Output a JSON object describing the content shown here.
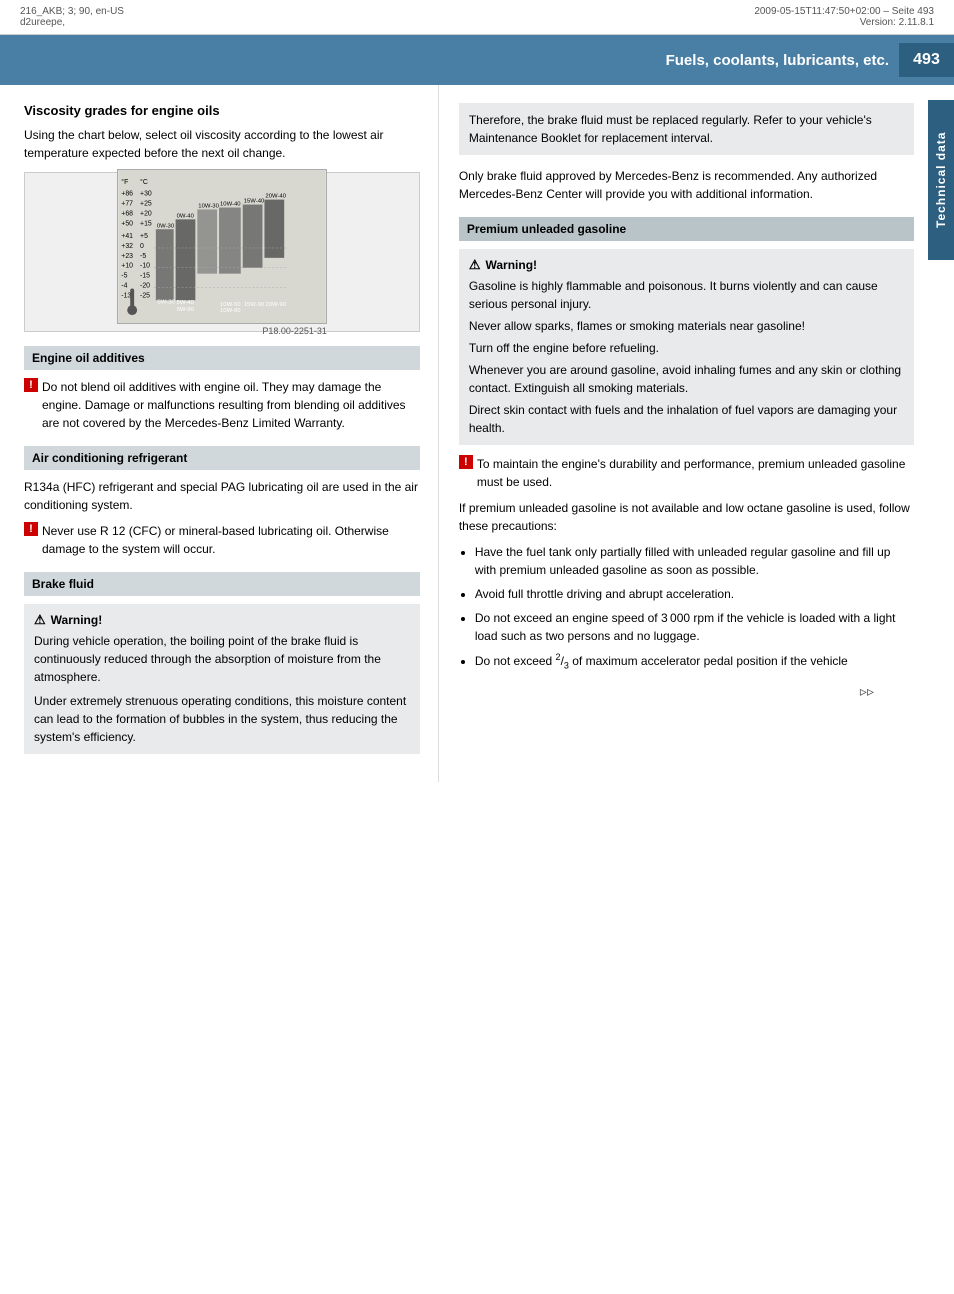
{
  "meta": {
    "top_left_line1": "216_AKB; 3; 90, en-US",
    "top_left_line2": "d2ureepe,",
    "top_right_line1": "2009-05-15T11:47:50+02:00 – Seite 493",
    "top_right_line2": "Version: 2.11.8.1"
  },
  "page_title": "Fuels, coolants, lubricants, etc.",
  "page_number": "493",
  "technical_data_tab": "Technical data",
  "left": {
    "viscosity": {
      "heading": "Viscosity grades for engine oils",
      "body": "Using the chart below, select oil viscosity according to the lowest air temperature expected before the next oil change.",
      "chart_caption": "P18.00-2251-31"
    },
    "engine_oil_additives": {
      "section_label": "Engine oil additives",
      "notice": "Do not blend oil additives with engine oil. They may damage the engine. Damage or malfunctions resulting from blending oil additives are not covered by the Mercedes-Benz Limited Warranty."
    },
    "air_conditioning": {
      "section_label": "Air conditioning refrigerant",
      "body": "R134a (HFC) refrigerant and special PAG lubricating oil are used in the air conditioning system.",
      "notice": "Never use R 12 (CFC) or mineral-based lubricating oil. Otherwise damage to the system will occur."
    },
    "brake_fluid": {
      "section_label": "Brake fluid",
      "warning_title": "Warning!",
      "warning_para1": "During vehicle operation, the boiling point of the brake fluid is continuously reduced through the absorption of moisture from the atmosphere.",
      "warning_para2": "Under extremely strenuous operating conditions, this moisture content can lead to the formation of bubbles in the system, thus reducing the system's efficiency."
    }
  },
  "right": {
    "brake_fluid_continued": {
      "boxed_text": "Therefore, the brake fluid must be replaced regularly. Refer to your vehicle's Maintenance Booklet for replacement interval.",
      "body": "Only brake fluid approved by Mercedes-Benz is recommended. Any authorized Mercedes-Benz Center will provide you with additional information."
    },
    "premium_gasoline": {
      "section_label": "Premium unleaded gasoline",
      "warning_title": "Warning!",
      "warning_lines": [
        "Gasoline is highly flammable and poisonous. It burns violently and can cause serious personal injury.",
        "Never allow sparks, flames or smoking materials near gasoline!",
        "Turn off the engine before refueling.",
        "Whenever you are around gasoline, avoid inhaling fumes and any skin or clothing contact. Extinguish all smoking materials.",
        "Direct skin contact with fuels and the inhalation of fuel vapors are damaging your health."
      ],
      "notice": "To maintain the engine's durability and performance, premium unleaded gasoline must be used.",
      "if_not_available": "If premium unleaded gasoline is not available and low octane gasoline is used, follow these precautions:",
      "precautions": [
        "Have the fuel tank only partially filled with unleaded regular gasoline and fill up with premium unleaded gasoline as soon as possible.",
        "Avoid full throttle driving and abrupt acceleration.",
        "Do not exceed an engine speed of 3 000 rpm if the vehicle is loaded with a light load such as two persons and no luggage.",
        "Do not exceed ²⁄₃ of maximum accelerator pedal position if the vehicle"
      ]
    }
  }
}
